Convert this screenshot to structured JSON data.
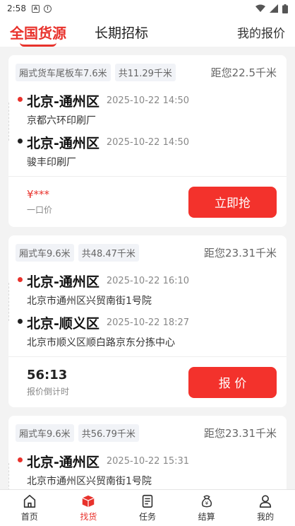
{
  "status": {
    "time": "2:58"
  },
  "header": {
    "tab_active": "全国货源",
    "tab_2": "长期招标",
    "right_link": "我的报价"
  },
  "cards": [
    {
      "tags": [
        "厢式货车尾板车7.6米",
        "共11.29千米"
      ],
      "distance": "距您22.5千米",
      "stops": [
        {
          "city": "北京-通州区",
          "time": "2025-10-22 14:50",
          "address": "京都六环印刷厂"
        },
        {
          "city": "北京-通州区",
          "time": "2025-10-22 14:50",
          "address": "骏丰印刷厂"
        }
      ],
      "price": "¥***",
      "price_label": "一口价",
      "action": "立即抢"
    },
    {
      "tags": [
        "厢式车9.6米",
        "共48.47千米"
      ],
      "distance": "距您23.31千米",
      "stops": [
        {
          "city": "北京-通州区",
          "time": "2025-10-22 16:10",
          "address": "北京市通州区兴贸南街1号院"
        },
        {
          "city": "北京-顺义区",
          "time": "2025-10-22 18:27",
          "address": "北京市顺义区顺白路京东分拣中心"
        }
      ],
      "countdown": "56:13",
      "countdown_label": "报价倒计时",
      "action": "报 价"
    },
    {
      "tags": [
        "厢式车9.6米",
        "共56.79千米"
      ],
      "distance": "距您23.31千米",
      "stops": [
        {
          "city": "北京-通州区",
          "time": "2025-10-22 15:31",
          "address": "北京市通州区兴贸南街1号院"
        }
      ]
    }
  ],
  "tabbar": [
    {
      "label": "首页",
      "icon": "home-icon"
    },
    {
      "label": "找货",
      "icon": "box-icon",
      "active": true
    },
    {
      "label": "任务",
      "icon": "task-icon"
    },
    {
      "label": "结算",
      "icon": "settlement-icon"
    },
    {
      "label": "我的",
      "icon": "profile-icon"
    }
  ],
  "colors": {
    "accent": "#e8322c",
    "button": "#f3322c"
  }
}
